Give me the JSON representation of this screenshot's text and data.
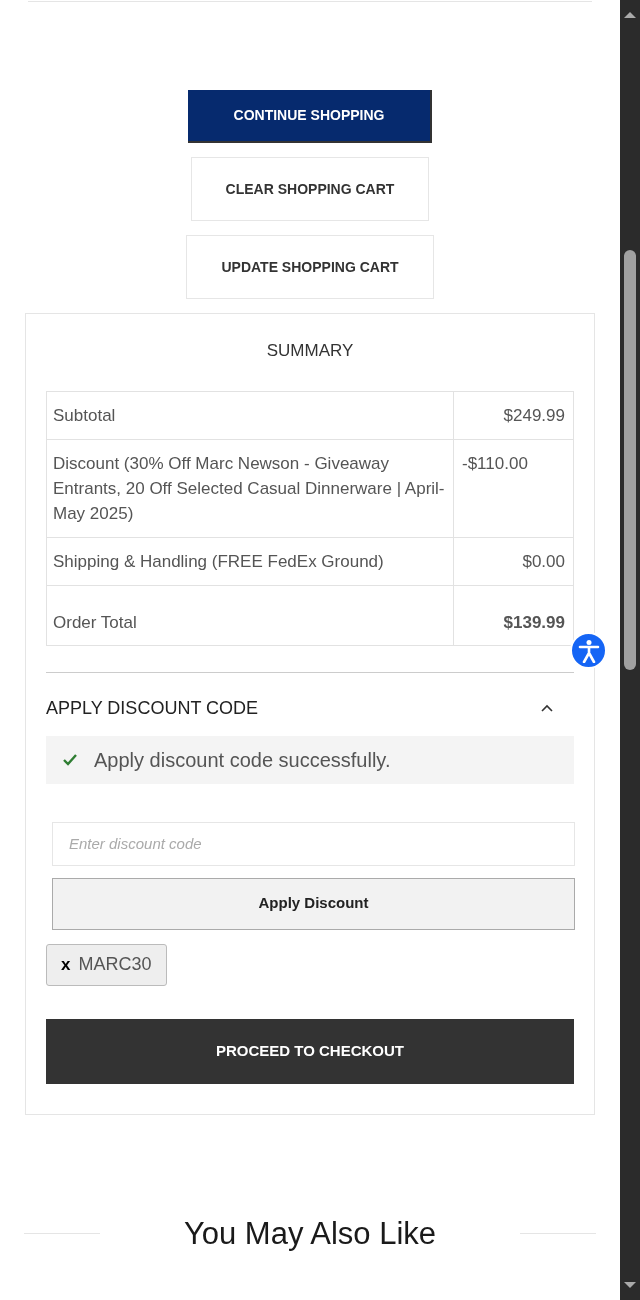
{
  "cart_actions": [
    {
      "label": "CONTINUE SHOPPING",
      "kind": "primary"
    },
    {
      "label": "CLEAR SHOPPING CART",
      "kind": "outline"
    },
    {
      "label": "UPDATE SHOPPING CART",
      "kind": "outline"
    }
  ],
  "summary": {
    "title": "SUMMARY",
    "rows": [
      {
        "label": "Subtotal",
        "value": "$249.99",
        "kind": "plain"
      },
      {
        "label": "Discount (30% Off Marc Newson - Giveaway Entrants, 20 Off Selected Casual Dinnerware | April-May 2025)",
        "value": "-$110.00",
        "kind": "discount"
      },
      {
        "label": "Shipping & Handling (FREE FedEx Ground)",
        "value": "$0.00",
        "kind": "plain"
      },
      {
        "label": "Order Total",
        "value": "$139.99",
        "kind": "total"
      }
    ],
    "discount": {
      "title": "APPLY DISCOUNT CODE",
      "expanded": true,
      "message": "Apply discount code successfully.",
      "placeholder": "Enter discount code",
      "button": "Apply Discount",
      "applied_codes": [
        {
          "remove": "x",
          "code": "MARC30"
        }
      ]
    },
    "checkout_button": "PROCEED TO CHECKOUT"
  },
  "recommendations": {
    "title": "You May Also Like"
  }
}
